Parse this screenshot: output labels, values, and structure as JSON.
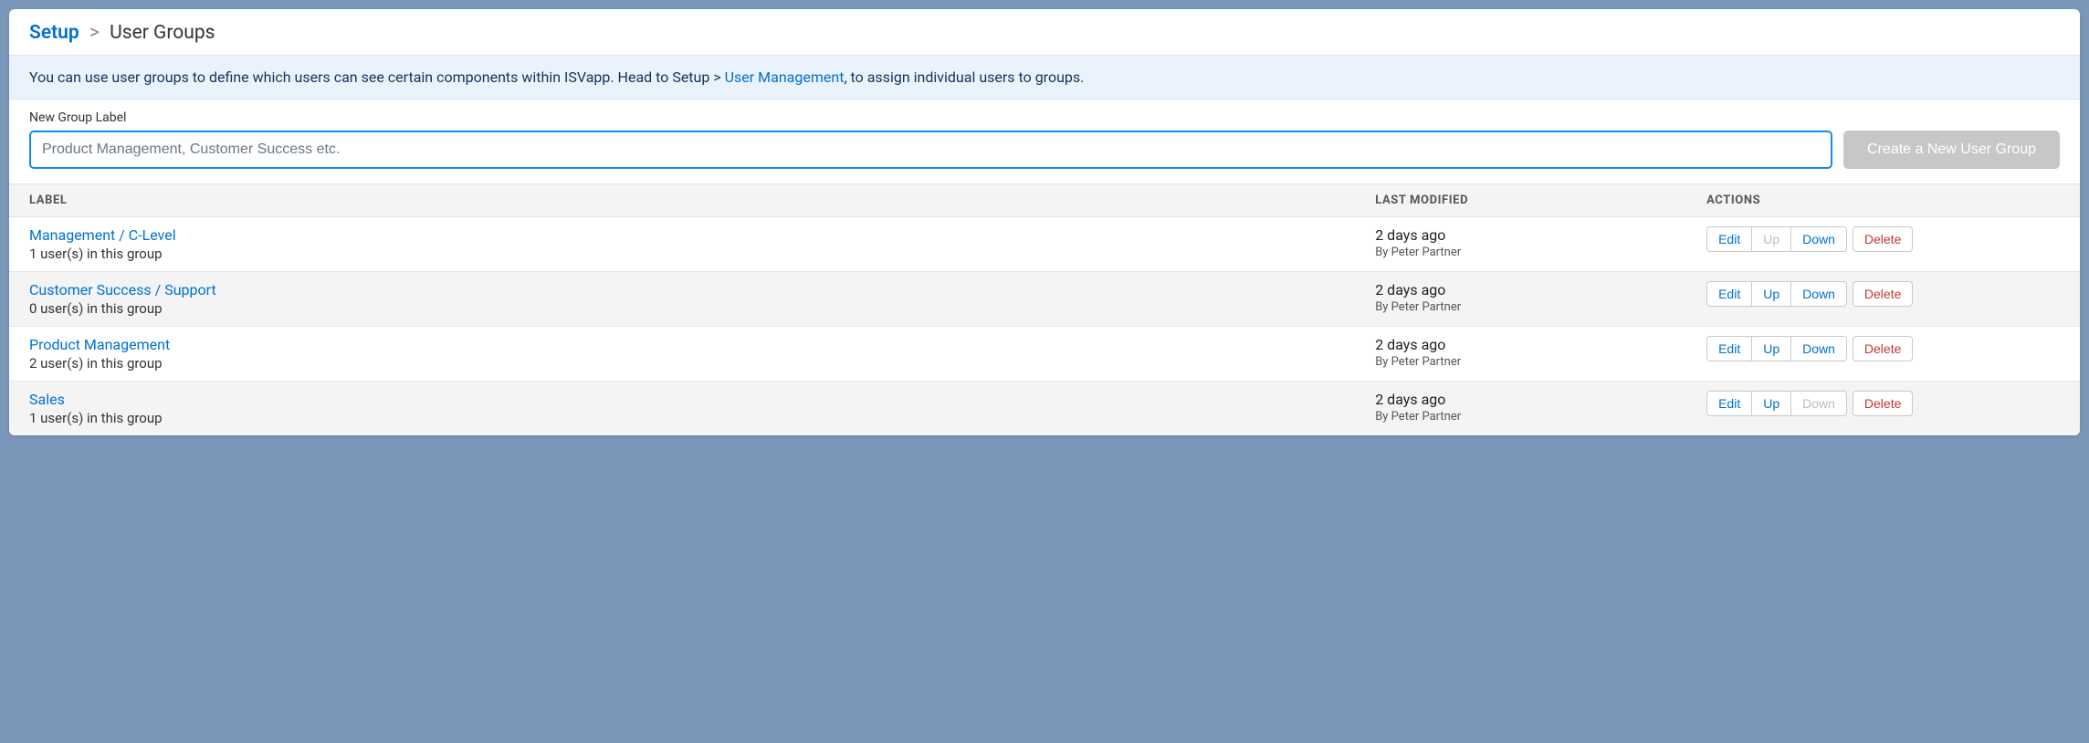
{
  "breadcrumb": {
    "root": "Setup",
    "separator": ">",
    "current": "User Groups"
  },
  "info": {
    "text_before": "You can use user groups to define which users can see certain components within ISVapp. Head to Setup > ",
    "link_text": "User Management",
    "text_after": ", to assign individual users to groups."
  },
  "form": {
    "label": "New Group Label",
    "placeholder": "Product Management, Customer Success etc.",
    "button": "Create a New User Group"
  },
  "table": {
    "headers": {
      "label": "LABEL",
      "modified": "LAST MODIFIED",
      "actions": "ACTIONS"
    },
    "action_labels": {
      "edit": "Edit",
      "up": "Up",
      "down": "Down",
      "delete": "Delete"
    }
  },
  "rows": [
    {
      "name": "Management / C-Level",
      "sub": "1 user(s) in this group",
      "modified": "2 days ago",
      "by": "By Peter Partner",
      "up_disabled": true,
      "down_disabled": false
    },
    {
      "name": "Customer Success / Support",
      "sub": "0 user(s) in this group",
      "modified": "2 days ago",
      "by": "By Peter Partner",
      "up_disabled": false,
      "down_disabled": false
    },
    {
      "name": "Product Management",
      "sub": "2 user(s) in this group",
      "modified": "2 days ago",
      "by": "By Peter Partner",
      "up_disabled": false,
      "down_disabled": false
    },
    {
      "name": "Sales",
      "sub": "1 user(s) in this group",
      "modified": "2 days ago",
      "by": "By Peter Partner",
      "up_disabled": false,
      "down_disabled": true
    }
  ]
}
